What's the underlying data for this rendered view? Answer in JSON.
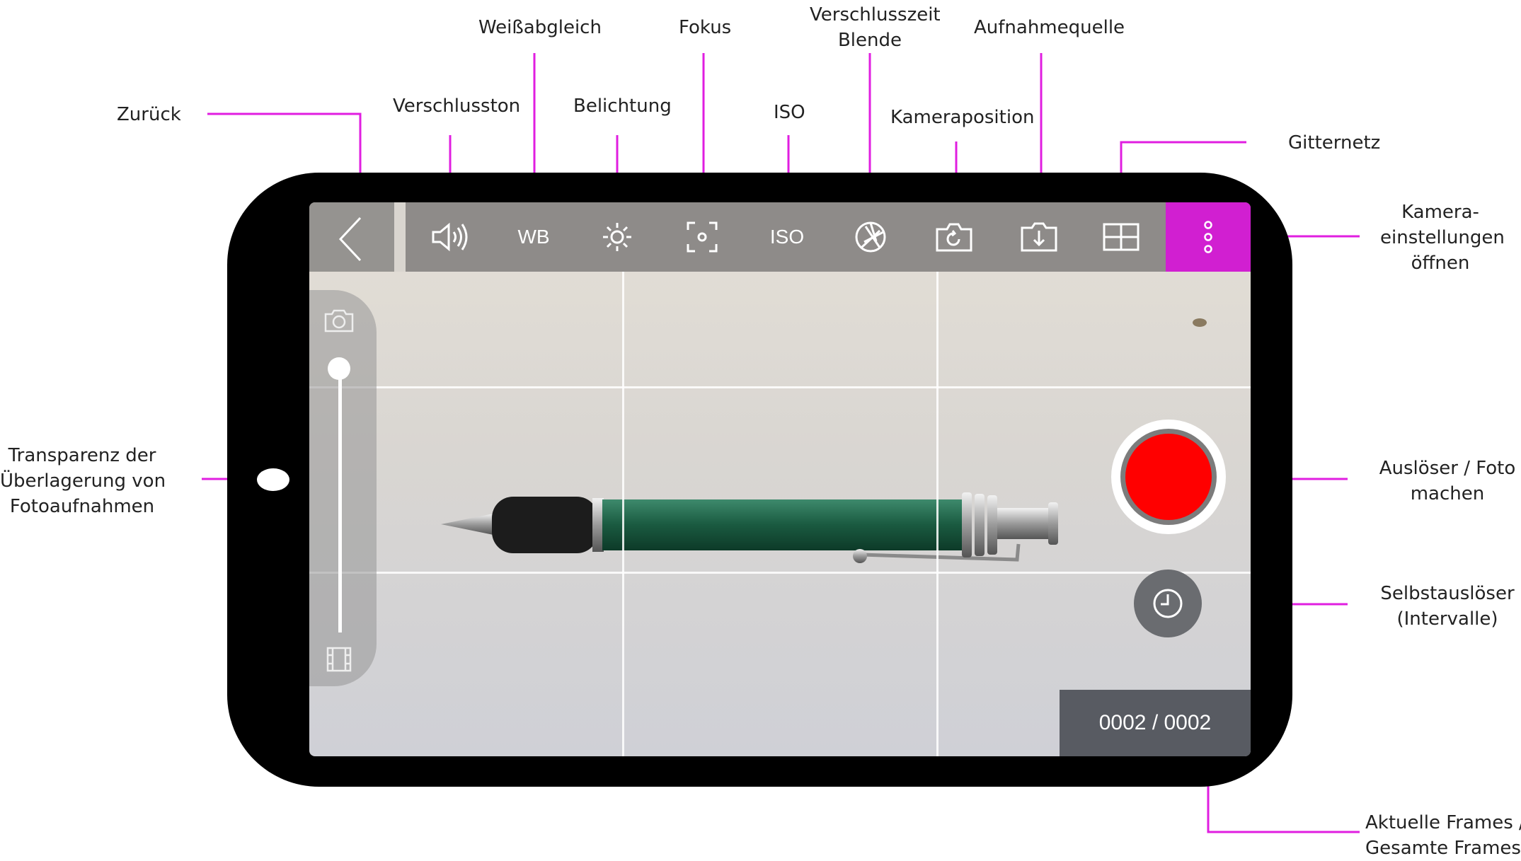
{
  "annotations": {
    "zurueck": "Zurück",
    "verschlusston": "Verschlusston",
    "weissabgleich": "Weißabgleich",
    "belichtung": "Belichtung",
    "fokus": "Fokus",
    "iso": "ISO",
    "verschlusszeit_l1": "Verschlusszeit",
    "verschlusszeit_l2": "Blende",
    "kameraposition": "Kameraposition",
    "aufnahmequelle": "Aufnahmequelle",
    "gitternetz": "Gitternetz",
    "kamera_l1": "Kamera-",
    "kamera_l2": "einstellungen",
    "kamera_l3": "öffnen",
    "transparenz_l1": "Transparenz der",
    "transparenz_l2": "Überlagerung von",
    "transparenz_l3": "Fotoaufnahmen",
    "ausloeser_l1": "Auslöser / Foto",
    "ausloeser_l2": "machen",
    "selbst_l1": "Selbstauslöser",
    "selbst_l2": "(Intervalle)",
    "frames_l1": "Aktuelle Frames /",
    "frames_l2": "Gesamte Frames"
  },
  "toolbar": {
    "wb_label": "WB",
    "iso_label": "ISO"
  },
  "frame_counter": "0002 / 0002",
  "colors": {
    "accent": "#d11fd1",
    "shutter": "#ff0000",
    "device": "#000000"
  },
  "icons": [
    "back-chevron-icon",
    "speaker-icon",
    "sun-icon",
    "focus-icon",
    "aperture-icon",
    "camera-rotate-icon",
    "download-tray-icon",
    "grid-icon",
    "more-dots-icon",
    "camera-icon",
    "film-icon",
    "timer-icon"
  ]
}
